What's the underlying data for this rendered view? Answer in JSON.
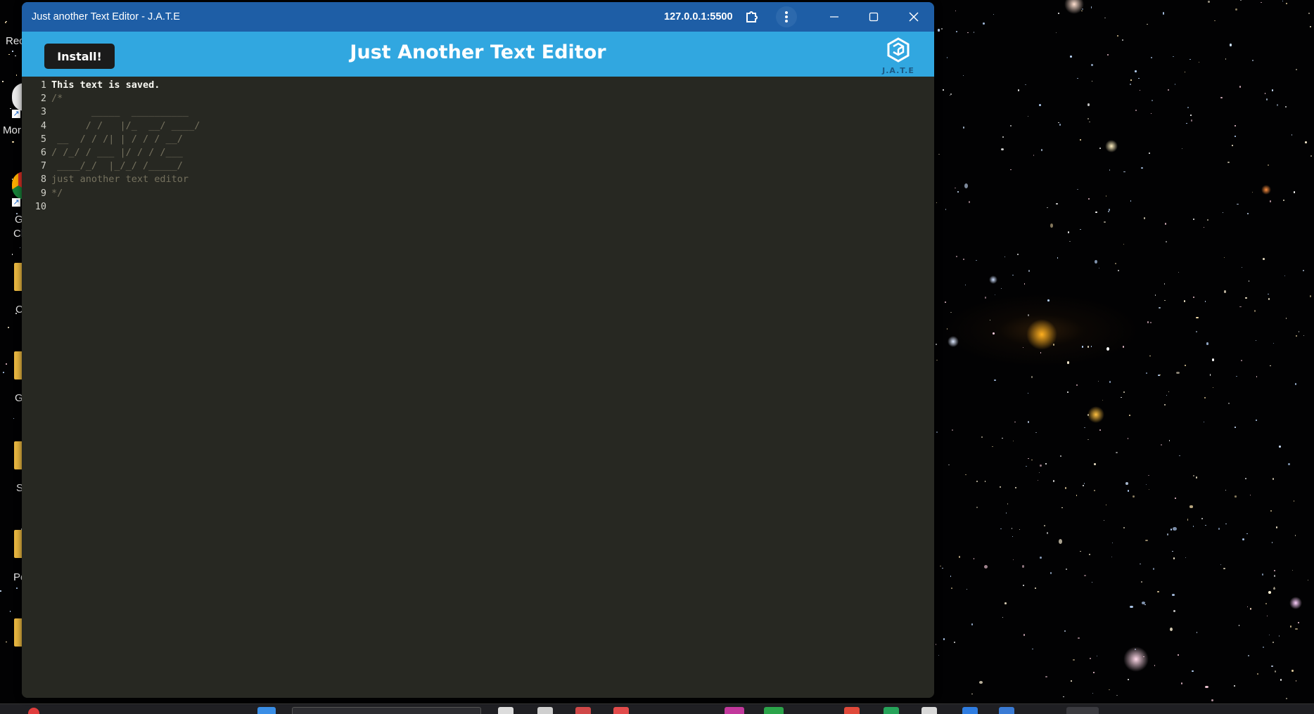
{
  "window": {
    "title": "Just another Text Editor - J.A.T.E",
    "url": "127.0.0.1:5500",
    "icons": [
      "extension-icon",
      "menu-dots-icon",
      "minimize-icon",
      "maximize-icon",
      "close-icon"
    ]
  },
  "app": {
    "install_label": "Install!",
    "title": "Just Another Text Editor",
    "logo_text": "J.A.T.E",
    "colors": {
      "titlebar": "#1e5ea6",
      "header": "#31a7e0",
      "editor_bg": "#272822",
      "install_btn": "#1b1b1b"
    }
  },
  "editor": {
    "lines": [
      {
        "num": "1",
        "text": "This text is saved.",
        "style": "plain"
      },
      {
        "num": "2",
        "text": "/*",
        "style": "comment"
      },
      {
        "num": "3",
        "text": "       _____  __________",
        "style": "comment"
      },
      {
        "num": "4",
        "text": "      / /   |/_  __/ ____/",
        "style": "comment"
      },
      {
        "num": "5",
        "text": " __  / / /| | / / / __/",
        "style": "comment"
      },
      {
        "num": "6",
        "text": "/ /_/ / ___ |/ / / /___",
        "style": "comment"
      },
      {
        "num": "7",
        "text": " ____/_/  |_/_/ /_____/",
        "style": "comment"
      },
      {
        "num": "8",
        "text": "just another text editor",
        "style": "comment"
      },
      {
        "num": "9",
        "text": "*/",
        "style": "comment"
      },
      {
        "num": "10",
        "text": "",
        "style": "plain"
      }
    ]
  },
  "desktop": {
    "icon_labels": [
      "Rec",
      "Mor",
      "G",
      "Cl",
      "C",
      "G",
      "S",
      "Pe"
    ]
  }
}
